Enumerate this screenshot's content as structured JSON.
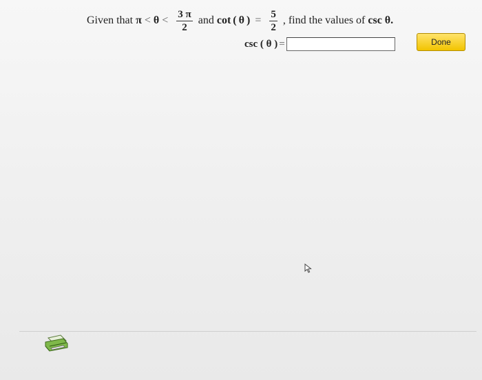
{
  "question": {
    "given_label": "Given that",
    "pi": "π",
    "less_than_1": "<",
    "theta": "θ",
    "less_than_2": "<",
    "frac1_num": "3 π",
    "frac1_den": "2",
    "and_label": "and",
    "cot_label": "cot",
    "paren_open": "(",
    "theta_2": "θ",
    "paren_close": ")",
    "equals": "=",
    "frac2_num": "5",
    "frac2_den": "2",
    "comma": ",",
    "find_label": "find the values of",
    "csc_theta_label": "csc θ.",
    "answer_label": "csc ( θ )",
    "answer_equals": "=",
    "answer_value": ""
  },
  "actions": {
    "done_label": "Done"
  },
  "icons": {
    "cursor": "mouse-pointer-icon",
    "printer": "printer-icon"
  }
}
